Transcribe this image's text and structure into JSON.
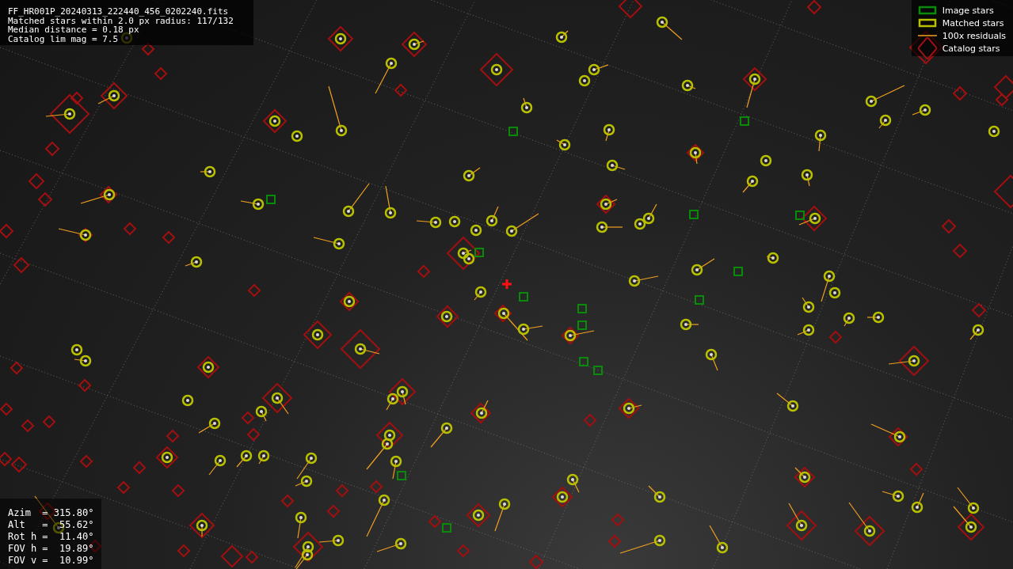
{
  "info_panel": {
    "lines": [
      "FF_HR001P_20240313_222440_456_0202240.fits",
      "Matched stars within 2.0 px radius: 117/132",
      "Median distance = 0.18 px",
      "Catalog lim mag = 7.5"
    ]
  },
  "legend": {
    "items": [
      {
        "kind": "image",
        "label": "Image stars"
      },
      {
        "kind": "matched",
        "label": "Matched stars"
      },
      {
        "kind": "residual",
        "label": "100x residuals"
      },
      {
        "kind": "catalog",
        "label": "Catalog stars"
      }
    ]
  },
  "pointing_panel": {
    "lines": [
      "Azim  = 315.80°",
      "Alt   =  55.62°",
      "Rot h =  11.40°",
      "FOV h =  19.89°",
      "FOV v =  10.99°"
    ]
  }
}
